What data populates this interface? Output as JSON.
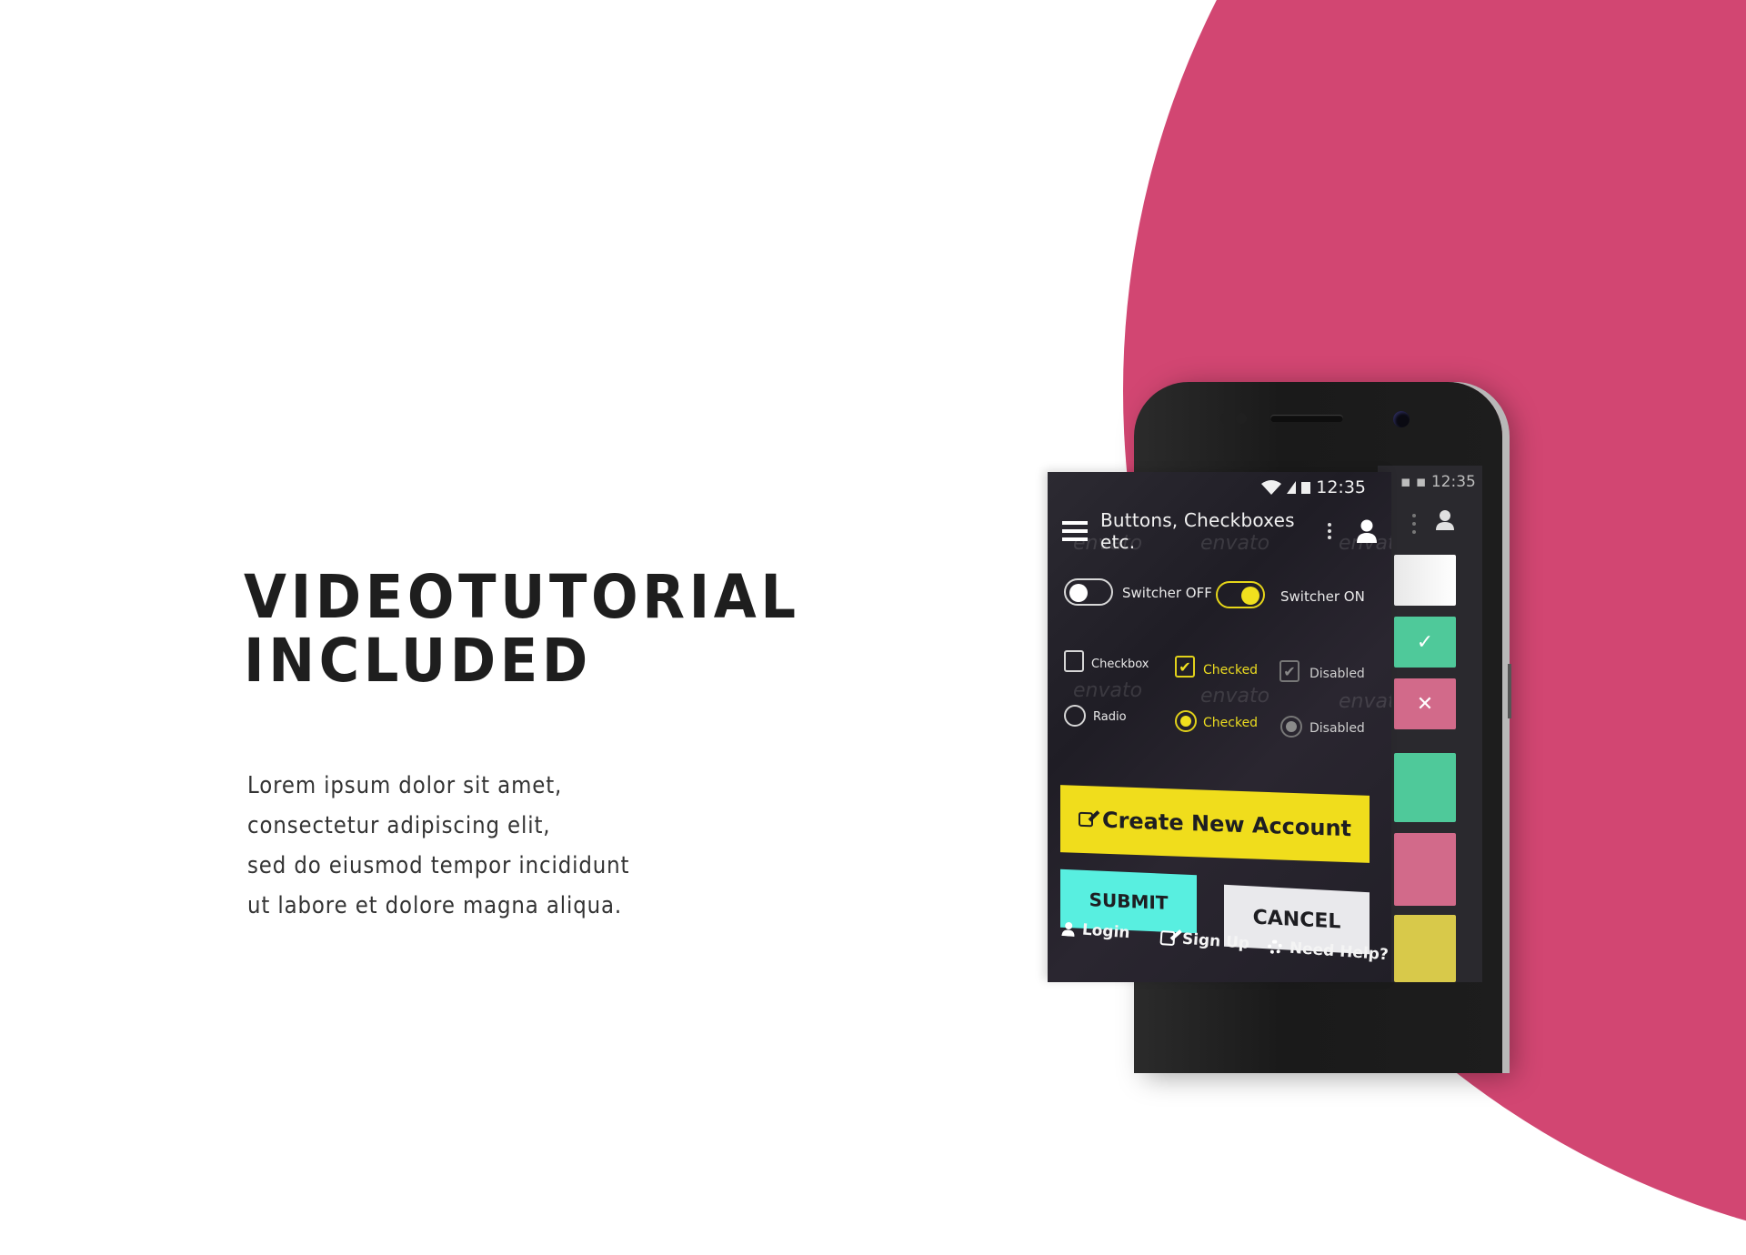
{
  "headline": {
    "line1": "VIDEOTUTORIAL",
    "line2": "INCLUDED"
  },
  "body_text": {
    "lines": [
      "Lorem ipsum dolor sit amet,",
      "consectetur adipiscing elit,",
      "sed do eiusmod tempor incididunt",
      "ut labore et dolore magna aliqua."
    ]
  },
  "colors": {
    "accent_pink": "#d24672",
    "accent_yellow": "#f0dd1c",
    "accent_cyan": "#58efe0",
    "tile_green": "#4fc99a",
    "tile_pink": "#d26a8a"
  },
  "phone": {
    "status_bar": {
      "time": "12:35",
      "icons": [
        "wifi-icon",
        "signal-icon",
        "battery-icon"
      ]
    },
    "app_bar": {
      "title": "Buttons, Checkboxes etc.",
      "menu_icon": "hamburger-icon",
      "overflow_icon": "kebab-icon",
      "profile_icon": "user-icon"
    },
    "watermark": "envato",
    "switches": [
      {
        "label": "Switcher OFF",
        "state": "off"
      },
      {
        "label": "Switcher ON",
        "state": "on"
      }
    ],
    "checkboxes": [
      {
        "label": "Checkbox",
        "state": "unchecked"
      },
      {
        "label": "Checked",
        "state": "checked"
      },
      {
        "label": "Disabled",
        "state": "disabled-checked"
      }
    ],
    "radios": [
      {
        "label": "Radio",
        "state": "unselected"
      },
      {
        "label": "Checked",
        "state": "selected"
      },
      {
        "label": "Disabled",
        "state": "disabled"
      }
    ],
    "buttons": {
      "create": "Create New Account",
      "submit": "SUBMIT",
      "cancel": "CANCEL"
    },
    "links": [
      {
        "label": "Login",
        "icon": "user-icon"
      },
      {
        "label": "Sign Up",
        "icon": "edit-icon"
      },
      {
        "label": "Need Help?",
        "icon": "lifebuoy-icon"
      }
    ],
    "back_screen": {
      "time": "12:35",
      "tiles": [
        {
          "color": "white",
          "icon": ""
        },
        {
          "color": "green",
          "icon": "✓"
        },
        {
          "color": "pink",
          "icon": "✕"
        },
        {
          "color": "green",
          "icon": ""
        },
        {
          "color": "pink",
          "icon": ""
        },
        {
          "color": "yellow",
          "icon": ""
        }
      ]
    }
  }
}
